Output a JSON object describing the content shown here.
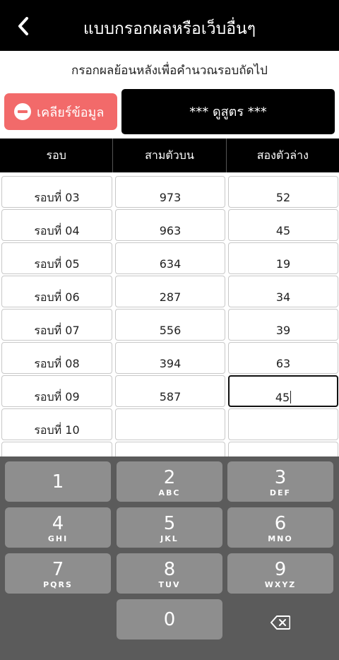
{
  "header": {
    "title": "แบบกรอกผลหรือเว็บอื่นๆ"
  },
  "subtitle": "กรอกผลย้อนหลังเพื่อคำนวณรอบถัดไป",
  "clear_button": {
    "label": "เคลียร์ข้อมูล"
  },
  "formula_button": {
    "label": "*** ดูสูตร ***"
  },
  "table": {
    "headers": [
      "รอบ",
      "สามตัวบน",
      "สองตัวล่าง"
    ],
    "rows": [
      {
        "round": "รอบที่ 03",
        "top3": "973",
        "bottom2": "52"
      },
      {
        "round": "รอบที่ 04",
        "top3": "963",
        "bottom2": "45"
      },
      {
        "round": "รอบที่ 05",
        "top3": "634",
        "bottom2": "19"
      },
      {
        "round": "รอบที่ 06",
        "top3": "287",
        "bottom2": "34"
      },
      {
        "round": "รอบที่ 07",
        "top3": "556",
        "bottom2": "39"
      },
      {
        "round": "รอบที่ 08",
        "top3": "394",
        "bottom2": "63"
      },
      {
        "round": "รอบที่ 09",
        "top3": "587",
        "bottom2": "45"
      },
      {
        "round": "รอบที่ 10",
        "top3": "",
        "bottom2": ""
      },
      {
        "round": "",
        "top3": "",
        "bottom2": ""
      }
    ]
  },
  "keyboard": {
    "keys": [
      {
        "num": "1",
        "letters": ""
      },
      {
        "num": "2",
        "letters": "ABC"
      },
      {
        "num": "3",
        "letters": "DEF"
      },
      {
        "num": "4",
        "letters": "GHI"
      },
      {
        "num": "5",
        "letters": "JKL"
      },
      {
        "num": "6",
        "letters": "MNO"
      },
      {
        "num": "7",
        "letters": "PQRS"
      },
      {
        "num": "8",
        "letters": "TUV"
      },
      {
        "num": "9",
        "letters": "WXYZ"
      },
      {
        "num": "0",
        "letters": ""
      }
    ]
  },
  "colors": {
    "header_bg": "#000000",
    "clear_bg": "#f26a6a",
    "keyboard_bg": "#5b5b5b",
    "key_bg": "#8e8e8e"
  }
}
